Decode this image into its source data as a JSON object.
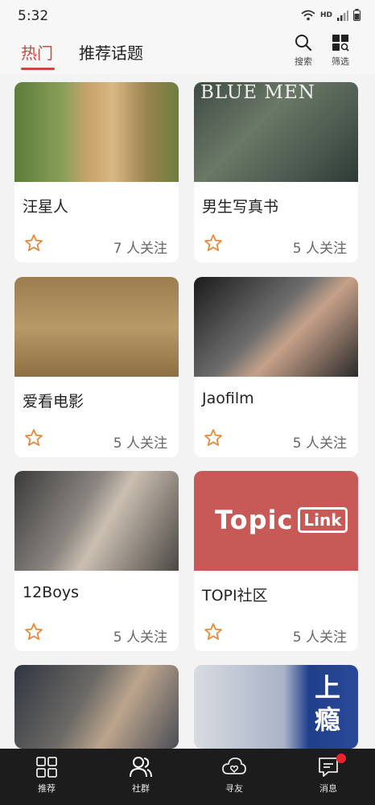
{
  "status_bar": {
    "time": "5:32",
    "network_label": "HD"
  },
  "header": {
    "tabs": [
      {
        "label": "热门",
        "active": true
      },
      {
        "label": "推荐话题",
        "active": false
      }
    ],
    "actions": [
      {
        "label": "搜索",
        "icon": "search-icon"
      },
      {
        "label": "筛选",
        "icon": "filter-icon"
      }
    ]
  },
  "colors": {
    "accent": "#c94a43",
    "star": "#e8893a",
    "tabbar_bg": "#1c1c1c",
    "badge": "#e8252e"
  },
  "cards": [
    {
      "title": "汪星人",
      "followers": "7 人关注",
      "image_text": ""
    },
    {
      "title": "男生写真书",
      "followers": "5 人关注",
      "image_text": "BLUE MEN"
    },
    {
      "title": "爱看电影",
      "followers": "5 人关注",
      "image_text": ""
    },
    {
      "title": "Jaofilm",
      "followers": "5 人关注",
      "image_text": ""
    },
    {
      "title": "12Boys",
      "followers": "5 人关注",
      "image_text": ""
    },
    {
      "title": "TOPI社区",
      "followers": "5 人关注",
      "image_text": "Topic",
      "image_text_badge": "Link"
    },
    {
      "title": "",
      "followers": "",
      "image_text": ""
    },
    {
      "title": "",
      "followers": "",
      "image_text": "上瘾"
    }
  ],
  "tabbar": {
    "items": [
      {
        "label": "推荐",
        "icon": "grid-icon"
      },
      {
        "label": "社群",
        "icon": "community-icon",
        "active": true
      },
      {
        "label": "寻友",
        "icon": "find-friends-icon"
      },
      {
        "label": "消息",
        "icon": "message-icon",
        "has_badge": true
      }
    ]
  }
}
